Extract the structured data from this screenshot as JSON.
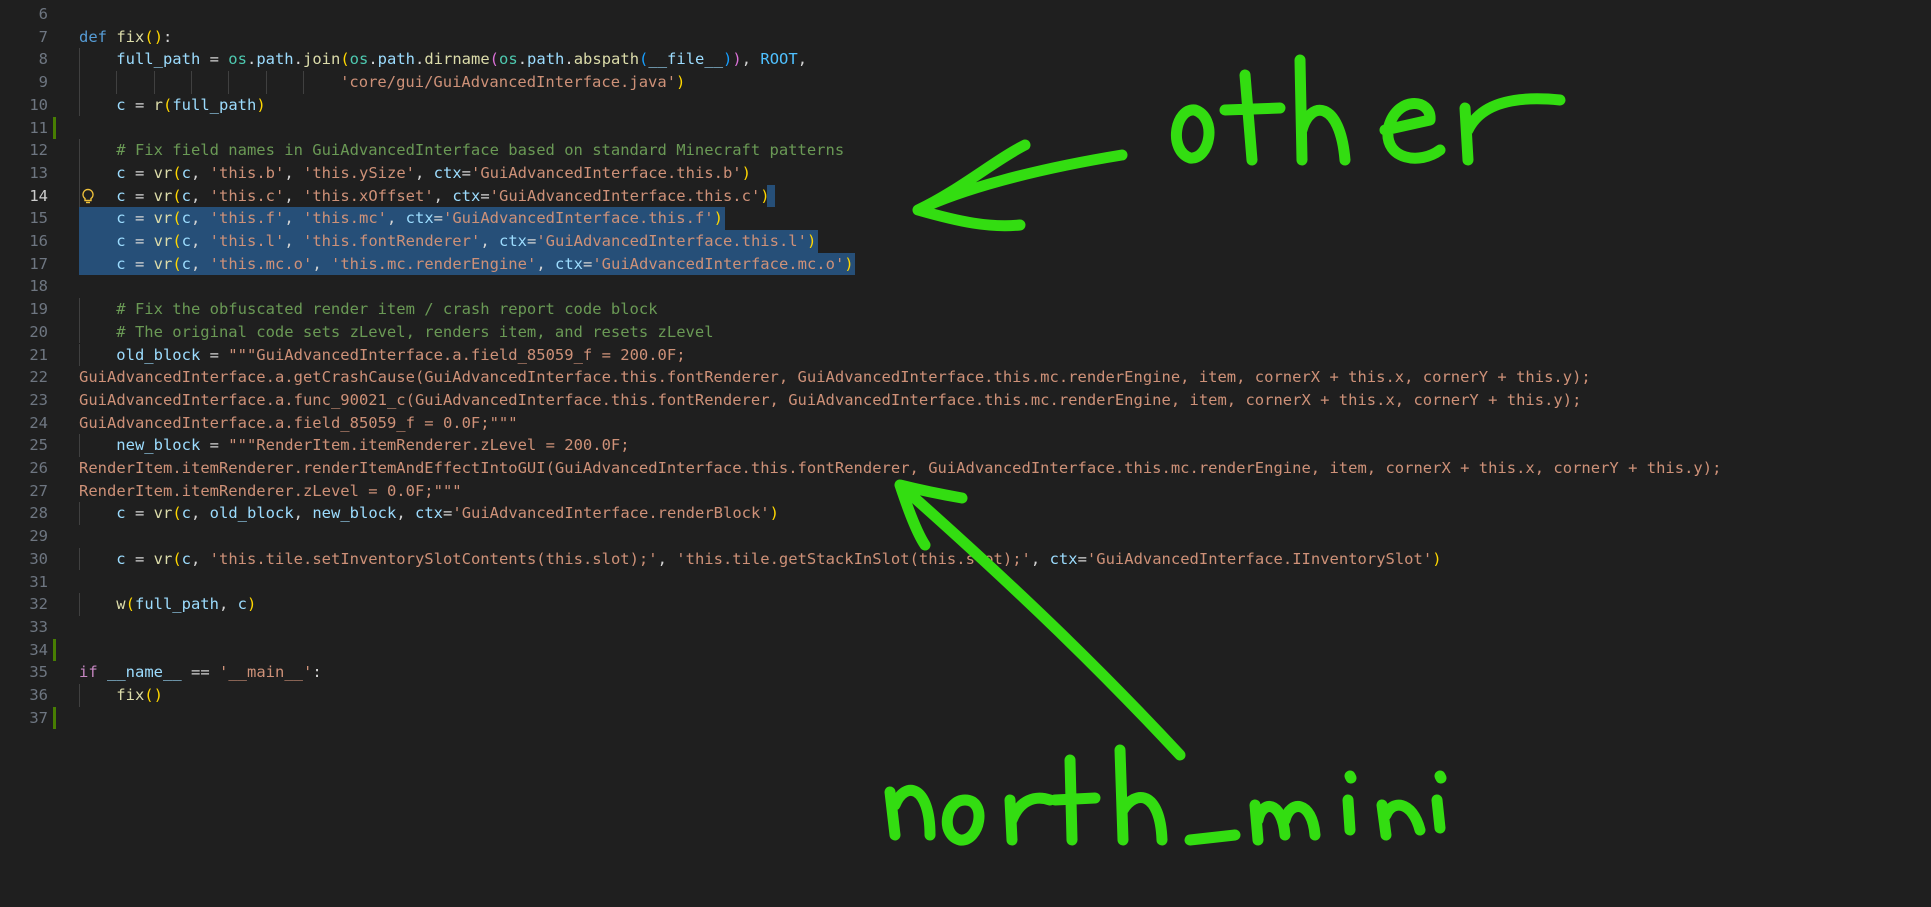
{
  "editor": {
    "lines": [
      {
        "n": "6",
        "segs": []
      },
      {
        "n": "7",
        "segs": [
          [
            "kw",
            "def"
          ],
          [
            "pn",
            " "
          ],
          [
            "fn",
            "fix"
          ],
          [
            "br1",
            "("
          ],
          [
            "br1",
            ")"
          ],
          [
            "pn",
            ":"
          ]
        ]
      },
      {
        "n": "8",
        "indent": 1,
        "segs": [
          [
            "vr",
            "full_path"
          ],
          [
            "pn",
            " = "
          ],
          [
            "cls",
            "os"
          ],
          [
            "pn",
            "."
          ],
          [
            "vr",
            "path"
          ],
          [
            "pn",
            "."
          ],
          [
            "fn",
            "join"
          ],
          [
            "br1",
            "("
          ],
          [
            "cls",
            "os"
          ],
          [
            "pn",
            "."
          ],
          [
            "vr",
            "path"
          ],
          [
            "pn",
            "."
          ],
          [
            "fn",
            "dirname"
          ],
          [
            "br2",
            "("
          ],
          [
            "cls",
            "os"
          ],
          [
            "pn",
            "."
          ],
          [
            "vr",
            "path"
          ],
          [
            "pn",
            "."
          ],
          [
            "fn",
            "abspath"
          ],
          [
            "br3",
            "("
          ],
          [
            "vr",
            "__file__"
          ],
          [
            "br3",
            ")"
          ],
          [
            "br2",
            ")"
          ],
          [
            "pn",
            ", "
          ],
          [
            "cst",
            "ROOT"
          ],
          [
            "pn",
            ","
          ]
        ]
      },
      {
        "n": "9",
        "indent": 7,
        "segs": [
          [
            "str",
            "'core/gui/GuiAdvancedInterface.java'"
          ],
          [
            "br1",
            ")"
          ]
        ]
      },
      {
        "n": "10",
        "indent": 1,
        "segs": [
          [
            "vr",
            "c"
          ],
          [
            "pn",
            " = "
          ],
          [
            "fn",
            "r"
          ],
          [
            "br1",
            "("
          ],
          [
            "vr",
            "full_path"
          ],
          [
            "br1",
            ")"
          ]
        ]
      },
      {
        "n": "11",
        "git": true,
        "segs": []
      },
      {
        "n": "12",
        "indent": 1,
        "segs": [
          [
            "cm",
            "# Fix field names in GuiAdvancedInterface based on standard Minecraft patterns"
          ]
        ]
      },
      {
        "n": "13",
        "indent": 1,
        "segs": [
          [
            "vr",
            "c"
          ],
          [
            "pn",
            " = "
          ],
          [
            "fn",
            "vr"
          ],
          [
            "br1",
            "("
          ],
          [
            "vr",
            "c"
          ],
          [
            "pn",
            ", "
          ],
          [
            "str",
            "'this.b'"
          ],
          [
            "pn",
            ", "
          ],
          [
            "str",
            "'this.ySize'"
          ],
          [
            "pn",
            ", "
          ],
          [
            "vr",
            "ctx"
          ],
          [
            "pn",
            "="
          ],
          [
            "str",
            "'GuiAdvancedInterface.this.b'"
          ],
          [
            "br1",
            ")"
          ]
        ]
      },
      {
        "n": "14",
        "indent": 1,
        "current": true,
        "bulb": true,
        "selTail": true,
        "segs": [
          [
            "vr",
            "c"
          ],
          [
            "pn",
            " = "
          ],
          [
            "fn",
            "vr"
          ],
          [
            "br1",
            "("
          ],
          [
            "vr",
            "c"
          ],
          [
            "pn",
            ", "
          ],
          [
            "str",
            "'this.c'"
          ],
          [
            "pn",
            ", "
          ],
          [
            "str",
            "'this.xOffset'"
          ],
          [
            "pn",
            ", "
          ],
          [
            "vr",
            "ctx"
          ],
          [
            "pn",
            "="
          ],
          [
            "str",
            "'GuiAdvancedInterface.this.c'"
          ],
          [
            "br1",
            ")"
          ]
        ]
      },
      {
        "n": "15",
        "indent": 1,
        "sel": true,
        "segs": [
          [
            "vr",
            "c"
          ],
          [
            "pn",
            " = "
          ],
          [
            "fn",
            "vr"
          ],
          [
            "br1",
            "("
          ],
          [
            "vr",
            "c"
          ],
          [
            "pn",
            ", "
          ],
          [
            "str",
            "'this.f'"
          ],
          [
            "pn",
            ", "
          ],
          [
            "str",
            "'this.mc'"
          ],
          [
            "pn",
            ", "
          ],
          [
            "vr",
            "ctx"
          ],
          [
            "pn",
            "="
          ],
          [
            "str",
            "'GuiAdvancedInterface.this.f'"
          ],
          [
            "br1",
            ")"
          ]
        ]
      },
      {
        "n": "16",
        "indent": 1,
        "sel": true,
        "segs": [
          [
            "vr",
            "c"
          ],
          [
            "pn",
            " = "
          ],
          [
            "fn",
            "vr"
          ],
          [
            "br1",
            "("
          ],
          [
            "vr",
            "c"
          ],
          [
            "pn",
            ", "
          ],
          [
            "str",
            "'this.l'"
          ],
          [
            "pn",
            ", "
          ],
          [
            "str",
            "'this.fontRenderer'"
          ],
          [
            "pn",
            ", "
          ],
          [
            "vr",
            "ctx"
          ],
          [
            "pn",
            "="
          ],
          [
            "str",
            "'GuiAdvancedInterface.this.l'"
          ],
          [
            "br1",
            ")"
          ]
        ]
      },
      {
        "n": "17",
        "indent": 1,
        "sel": true,
        "segs": [
          [
            "vr",
            "c"
          ],
          [
            "pn",
            " = "
          ],
          [
            "fn",
            "vr"
          ],
          [
            "br1",
            "("
          ],
          [
            "vr",
            "c"
          ],
          [
            "pn",
            ", "
          ],
          [
            "str",
            "'this.mc.o'"
          ],
          [
            "pn",
            ", "
          ],
          [
            "str",
            "'this.mc.renderEngine'"
          ],
          [
            "pn",
            ", "
          ],
          [
            "vr",
            "ctx"
          ],
          [
            "pn",
            "="
          ],
          [
            "str",
            "'GuiAdvancedInterface.mc.o'"
          ],
          [
            "br1",
            ")"
          ]
        ]
      },
      {
        "n": "18",
        "segs": []
      },
      {
        "n": "19",
        "indent": 1,
        "segs": [
          [
            "cm",
            "# Fix the obfuscated render item / crash report code block"
          ]
        ]
      },
      {
        "n": "20",
        "indent": 1,
        "segs": [
          [
            "cm",
            "# The original code sets zLevel, renders item, and resets zLevel"
          ]
        ]
      },
      {
        "n": "21",
        "indent": 1,
        "segs": [
          [
            "vr",
            "old_block"
          ],
          [
            "pn",
            " = "
          ],
          [
            "str",
            "\"\"\"GuiAdvancedInterface.a.field_85059_f = 200.0F;"
          ]
        ]
      },
      {
        "n": "22",
        "segs": [
          [
            "str",
            "GuiAdvancedInterface.a.getCrashCause(GuiAdvancedInterface.this.fontRenderer, GuiAdvancedInterface.this.mc.renderEngine, item, cornerX + this.x, cornerY + this.y);"
          ]
        ]
      },
      {
        "n": "23",
        "segs": [
          [
            "str",
            "GuiAdvancedInterface.a.func_90021_c(GuiAdvancedInterface.this.fontRenderer, GuiAdvancedInterface.this.mc.renderEngine, item, cornerX + this.x, cornerY + this.y);"
          ]
        ]
      },
      {
        "n": "24",
        "segs": [
          [
            "str",
            "GuiAdvancedInterface.a.field_85059_f = 0.0F;\"\"\""
          ]
        ]
      },
      {
        "n": "25",
        "indent": 1,
        "segs": [
          [
            "vr",
            "new_block"
          ],
          [
            "pn",
            " = "
          ],
          [
            "str",
            "\"\"\"RenderItem.itemRenderer.zLevel = 200.0F;"
          ]
        ]
      },
      {
        "n": "26",
        "segs": [
          [
            "str",
            "RenderItem.itemRenderer.renderItemAndEffectIntoGUI(GuiAdvancedInterface.this.fontRenderer, GuiAdvancedInterface.this.mc.renderEngine, item, cornerX + this.x, cornerY + this.y);"
          ]
        ]
      },
      {
        "n": "27",
        "segs": [
          [
            "str",
            "RenderItem.itemRenderer.zLevel = 0.0F;\"\"\""
          ]
        ]
      },
      {
        "n": "28",
        "indent": 1,
        "segs": [
          [
            "vr",
            "c"
          ],
          [
            "pn",
            " = "
          ],
          [
            "fn",
            "vr"
          ],
          [
            "br1",
            "("
          ],
          [
            "vr",
            "c"
          ],
          [
            "pn",
            ", "
          ],
          [
            "vr",
            "old_block"
          ],
          [
            "pn",
            ", "
          ],
          [
            "vr",
            "new_block"
          ],
          [
            "pn",
            ", "
          ],
          [
            "vr",
            "ctx"
          ],
          [
            "pn",
            "="
          ],
          [
            "str",
            "'GuiAdvancedInterface.renderBlock'"
          ],
          [
            "br1",
            ")"
          ]
        ]
      },
      {
        "n": "29",
        "segs": []
      },
      {
        "n": "30",
        "indent": 1,
        "segs": [
          [
            "vr",
            "c"
          ],
          [
            "pn",
            " = "
          ],
          [
            "fn",
            "vr"
          ],
          [
            "br1",
            "("
          ],
          [
            "vr",
            "c"
          ],
          [
            "pn",
            ", "
          ],
          [
            "str",
            "'this.tile.setInventorySlotContents(this.slot);'"
          ],
          [
            "pn",
            ", "
          ],
          [
            "str",
            "'this.tile.getStackInSlot(this.slot);'"
          ],
          [
            "pn",
            ", "
          ],
          [
            "vr",
            "ctx"
          ],
          [
            "pn",
            "="
          ],
          [
            "str",
            "'GuiAdvancedInterface.IInventorySlot'"
          ],
          [
            "br1",
            ")"
          ]
        ]
      },
      {
        "n": "31",
        "segs": []
      },
      {
        "n": "32",
        "indent": 1,
        "segs": [
          [
            "fn",
            "w"
          ],
          [
            "br1",
            "("
          ],
          [
            "vr",
            "full_path"
          ],
          [
            "pn",
            ", "
          ],
          [
            "vr",
            "c"
          ],
          [
            "br1",
            ")"
          ]
        ]
      },
      {
        "n": "33",
        "segs": []
      },
      {
        "n": "34",
        "git": true,
        "segs": []
      },
      {
        "n": "35",
        "segs": [
          [
            "ctl",
            "if"
          ],
          [
            "pn",
            " "
          ],
          [
            "vr",
            "__name__"
          ],
          [
            "pn",
            " == "
          ],
          [
            "str",
            "'__main__'"
          ],
          [
            "pn",
            ":"
          ]
        ]
      },
      {
        "n": "36",
        "indent": 1,
        "segs": [
          [
            "fn",
            "fix"
          ],
          [
            "br1",
            "("
          ],
          [
            "br1",
            ")"
          ]
        ]
      },
      {
        "n": "37",
        "git": true,
        "segs": []
      }
    ]
  },
  "annotations": {
    "color": "#33dd11",
    "label_other": "other",
    "label_north_mini": "north_mini"
  },
  "colors": {
    "background": "#1f1f1f",
    "selection": "#264f78",
    "git_added": "#487e02",
    "lightbulb": "#f0c23b"
  }
}
